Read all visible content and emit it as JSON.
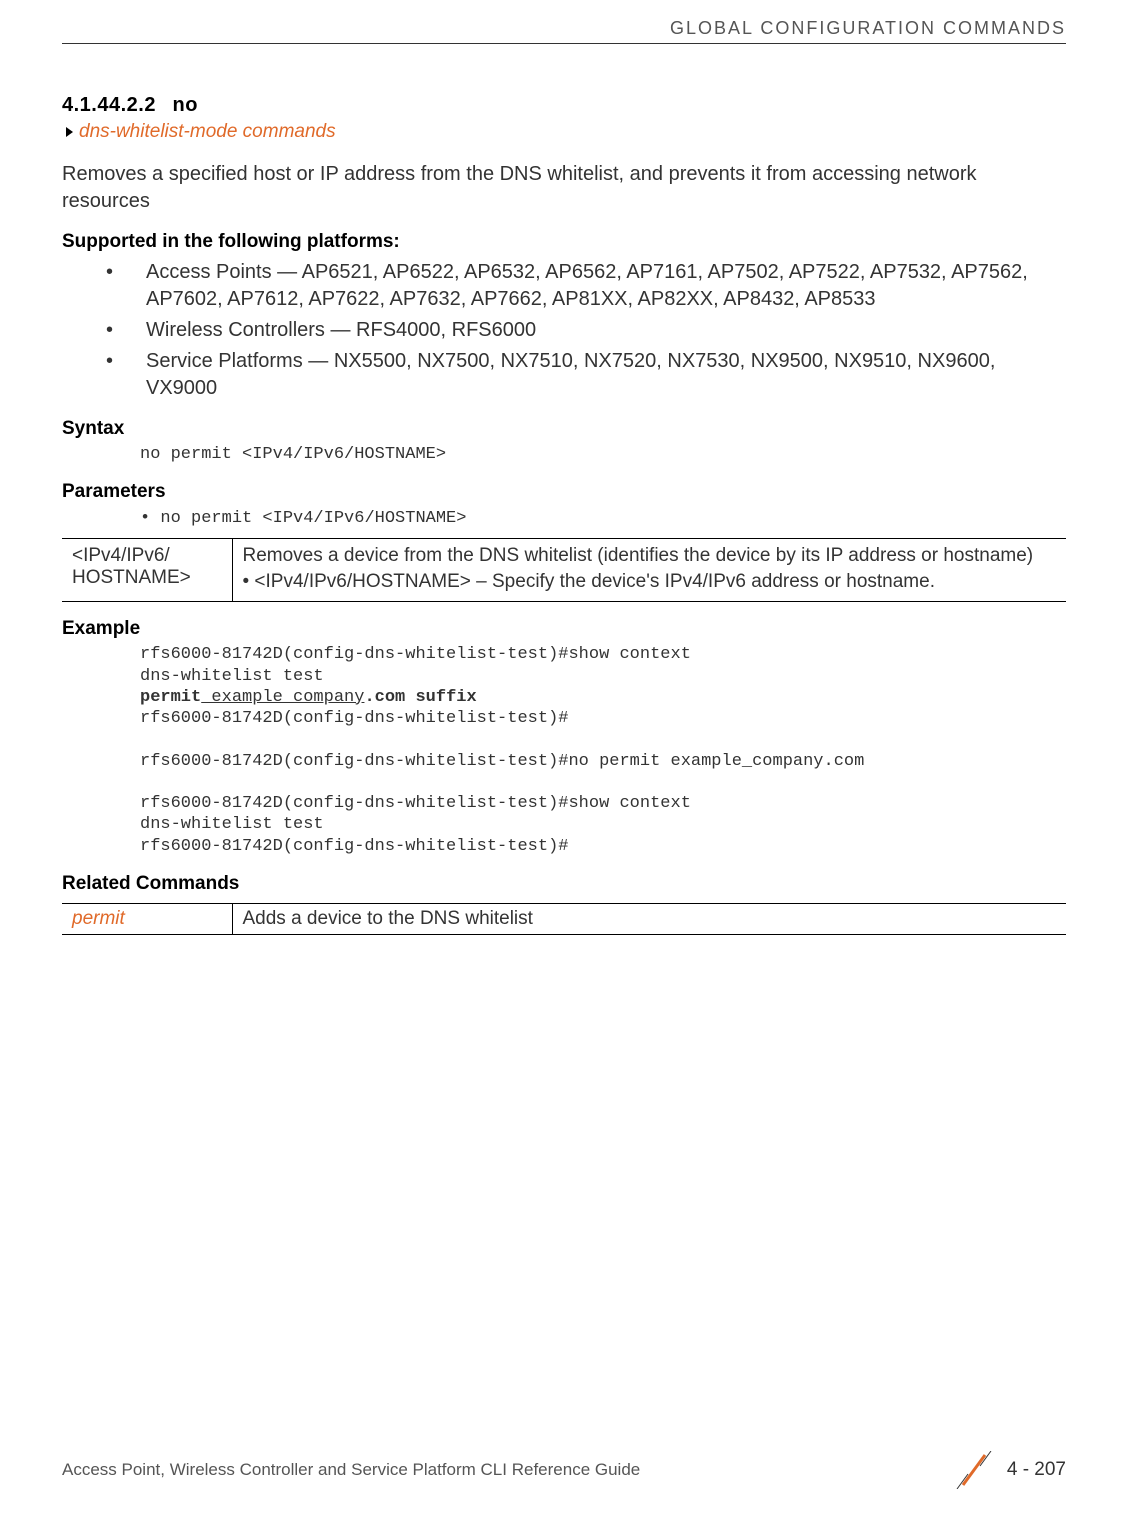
{
  "header": {
    "running_head": "GLOBAL CONFIGURATION COMMANDS"
  },
  "section": {
    "number": "4.1.44.2.2",
    "title": "no",
    "breadcrumb": "dns-whitelist-mode commands",
    "intro": "Removes a specified host or IP address from the DNS whitelist, and prevents it from accessing network resources"
  },
  "supported": {
    "heading": "Supported in the following platforms:",
    "items": [
      "Access Points — AP6521, AP6522, AP6532, AP6562, AP7161, AP7502, AP7522, AP7532, AP7562, AP7602, AP7612, AP7622, AP7632, AP7662, AP81XX, AP82XX, AP8432, AP8533",
      "Wireless Controllers — RFS4000, RFS6000",
      "Service Platforms — NX5500, NX7500, NX7510, NX7520, NX7530, NX9500, NX9510, NX9600, VX9000"
    ]
  },
  "syntax": {
    "heading": "Syntax",
    "code": "no permit <IPv4/IPv6/HOSTNAME>"
  },
  "parameters": {
    "heading": "Parameters",
    "line_prefix": "• ",
    "line": "no permit <IPv4/IPv6/HOSTNAME>",
    "table": {
      "col1": "<IPv4/IPv6/\nHOSTNAME>",
      "col2_main": "Removes a device from the DNS whitelist (identifies the device by its IP address or hostname)",
      "col2_sub": "•  <IPv4/IPv6/HOSTNAME> – Specify the device's IPv4/IPv6 address or hostname."
    }
  },
  "example": {
    "heading": "Example",
    "l1": "rfs6000-81742D(config-dns-whitelist-test)#show context",
    "l2": "dns-whitelist test",
    "l3a": "permit",
    "l3b": " example_company",
    "l3c": ".com suffix",
    "l4": "rfs6000-81742D(config-dns-whitelist-test)#",
    "l5": "",
    "l6": "rfs6000-81742D(config-dns-whitelist-test)#no permit example_company.com",
    "l7": "",
    "l8": "rfs6000-81742D(config-dns-whitelist-test)#show context",
    "l9": "dns-whitelist test",
    "l10": "rfs6000-81742D(config-dns-whitelist-test)#"
  },
  "related": {
    "heading": "Related Commands",
    "table": {
      "col1": "permit",
      "col2": "Adds a device to the DNS whitelist"
    }
  },
  "footer": {
    "left": "Access Point, Wireless Controller and Service Platform CLI Reference Guide",
    "page": "4 - 207"
  }
}
